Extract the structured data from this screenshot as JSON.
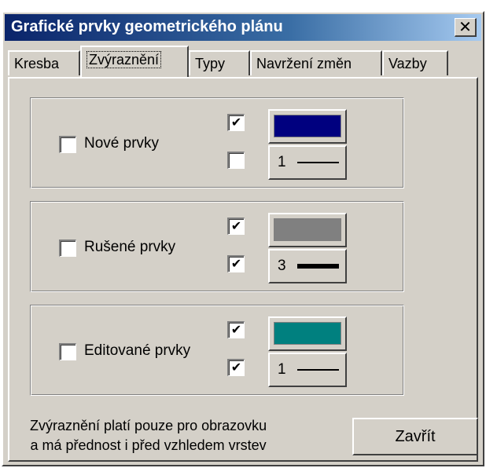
{
  "window": {
    "title": "Grafické prvky geometrického plánu",
    "close_glyph": "✕"
  },
  "tabs": [
    {
      "label": "Kresba",
      "active": false
    },
    {
      "label": "Zvýraznění",
      "active": true
    },
    {
      "label": "Typy",
      "active": false
    },
    {
      "label": "Navržení změn",
      "active": false
    },
    {
      "label": "Vazby",
      "active": false
    }
  ],
  "groups": [
    {
      "label": "Nové prvky",
      "main_checked": false,
      "color_checked": true,
      "line_checked": false,
      "color": "#00007f",
      "line_width_label": "1",
      "line_width": 1
    },
    {
      "label": "Rušené prvky",
      "main_checked": false,
      "color_checked": true,
      "line_checked": true,
      "color": "#808080",
      "line_width_label": "3",
      "line_width": 3
    },
    {
      "label": "Editované prvky",
      "main_checked": false,
      "color_checked": true,
      "line_checked": true,
      "color": "#00807f",
      "line_width_label": "1",
      "line_width": 1
    }
  ],
  "note": {
    "line1": "Zvýraznění platí pouze pro obrazovku",
    "line2": "a má přednost i před vzhledem vrstev"
  },
  "close_button_label": "Zavřít",
  "check_glyph": "✔"
}
